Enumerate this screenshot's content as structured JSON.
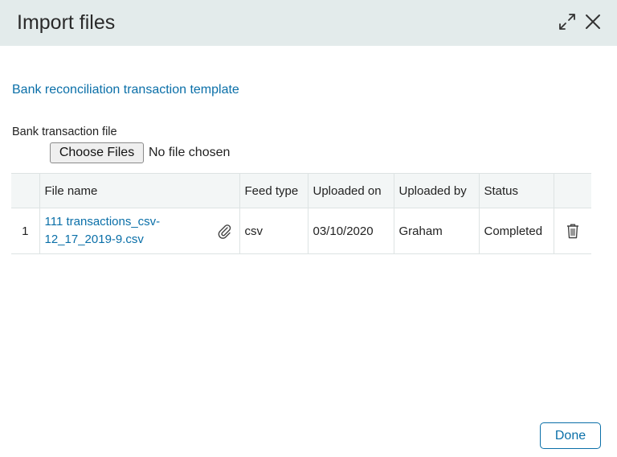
{
  "dialog": {
    "title": "Import files"
  },
  "template_link": "Bank reconciliation transaction template",
  "file_input": {
    "label": "Bank transaction file",
    "button_label": "Choose Files",
    "status": "No file chosen"
  },
  "table": {
    "headers": {
      "index": "",
      "file_name": "File name",
      "feed_type": "Feed type",
      "uploaded_on": "Uploaded on",
      "uploaded_by": "Uploaded by",
      "status": "Status",
      "actions": ""
    },
    "rows": [
      {
        "index": "1",
        "file_name": "111 transactions_csv-12_17_2019-9.csv",
        "feed_type": "csv",
        "uploaded_on": "03/10/2020",
        "uploaded_by": "Graham",
        "status": "Completed"
      }
    ]
  },
  "footer": {
    "done_label": "Done"
  },
  "icons": {
    "expand": "expand-icon",
    "close": "close-icon",
    "attachment": "paperclip-icon",
    "delete": "trash-icon"
  },
  "colors": {
    "header_bg": "#e3ebeb",
    "link": "#0a6fa8",
    "table_header_bg": "#f3f6f6"
  }
}
